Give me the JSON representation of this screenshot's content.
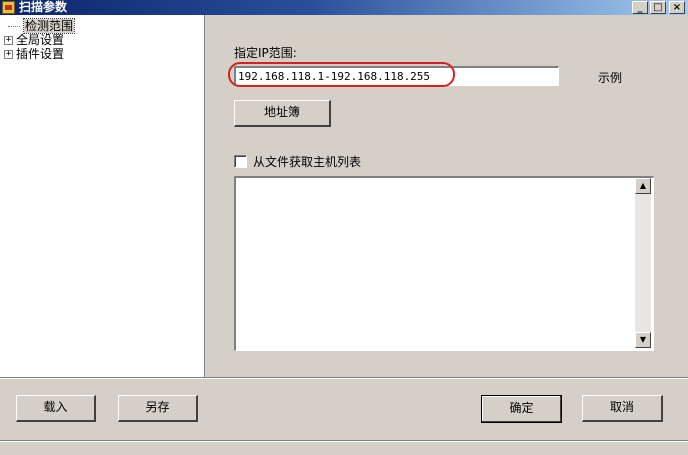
{
  "window": {
    "title": "扫描参数",
    "minimize_glyph": "_",
    "maximize_glyph": "□",
    "close_glyph": "×"
  },
  "tree": {
    "items": [
      {
        "label": "检测范围",
        "expander": "",
        "selected": true
      },
      {
        "label": "全局设置",
        "expander": "+",
        "selected": false
      },
      {
        "label": "插件设置",
        "expander": "+",
        "selected": false
      }
    ]
  },
  "range": {
    "ip_label": "指定IP范围:",
    "ip_value": "192.168.118.1-192.168.118.255",
    "example_label": "示例",
    "address_book_button": "地址簿",
    "from_file_checkbox_label": "从文件获取主机列表",
    "from_file_checked": false,
    "scroll_up_glyph": "▲",
    "scroll_down_glyph": "▼"
  },
  "footer": {
    "load_button": "载入",
    "save_as_button": "另存",
    "ok_button": "确定",
    "cancel_button": "取消"
  },
  "colors": {
    "title_gradient_start": "#0a246a",
    "highlight_ellipse": "#d42020",
    "dialog_face": "#d4d0c8"
  }
}
